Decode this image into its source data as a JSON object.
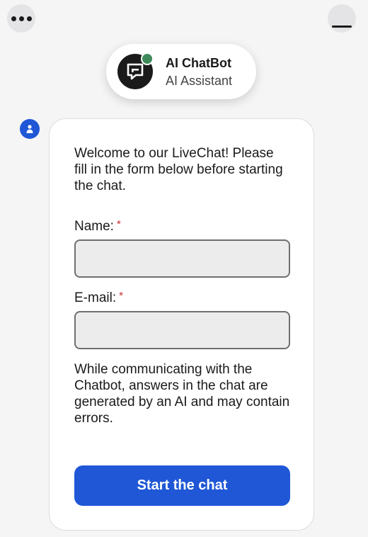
{
  "window": {
    "menu_icon": "more-dots-icon",
    "minimize_icon": "minimize-icon"
  },
  "header": {
    "bot_name": "AI ChatBot",
    "bot_role": "AI Assistant",
    "avatar_icon": "chat-bubble-icon",
    "status_color": "#3d8a5a"
  },
  "message": {
    "sender_icon": "user-icon",
    "welcome_text": "Welcome to our LiveChat! Please fill in the form below before starting the chat.",
    "form": {
      "name_label": "Name:",
      "name_value": "",
      "email_label": "E-mail:",
      "email_value": "",
      "required_marker": "*"
    },
    "disclaimer": "While communicating with the Chatbot, answers in the chat are generated by an AI and may contain errors.",
    "start_button_label": "Start the chat"
  },
  "colors": {
    "accent": "#1f57d6",
    "required": "#c8312b"
  }
}
